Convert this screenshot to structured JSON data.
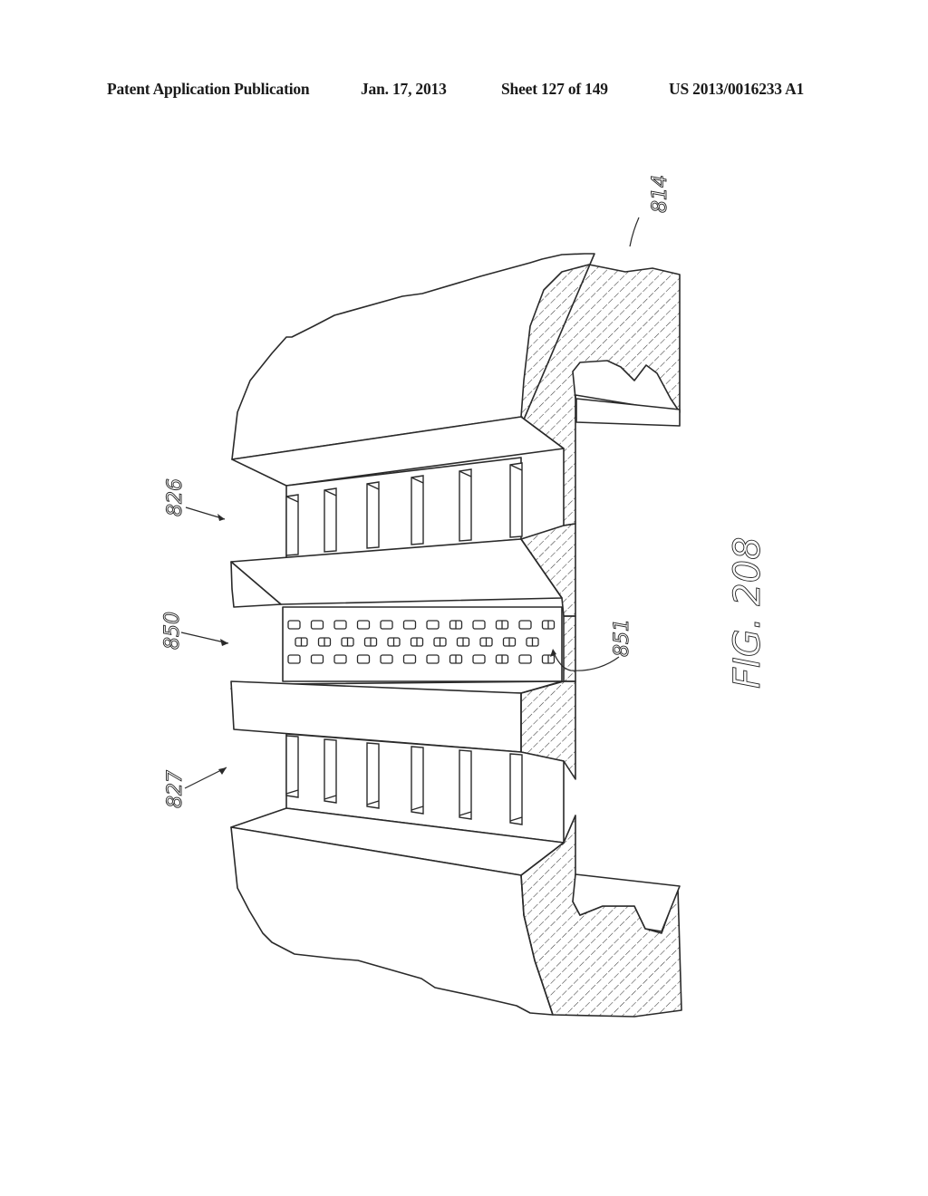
{
  "header": {
    "publication": "Patent Application Publication",
    "date": "Jan. 17, 2013",
    "sheet": "Sheet 127 of 149",
    "number": "US 2013/0016233 A1"
  },
  "figure": {
    "caption": "FIG. 208",
    "labels": {
      "ref_814": "814",
      "ref_826": "826",
      "ref_850": "850",
      "ref_827": "827",
      "ref_851": "851"
    },
    "colors": {
      "line": "#2a2a2a",
      "hatch": "#3a3a3a",
      "background": "#ffffff"
    },
    "slot_columns": 6,
    "nozzle_rows": 3,
    "nozzles_per_row": 12
  }
}
